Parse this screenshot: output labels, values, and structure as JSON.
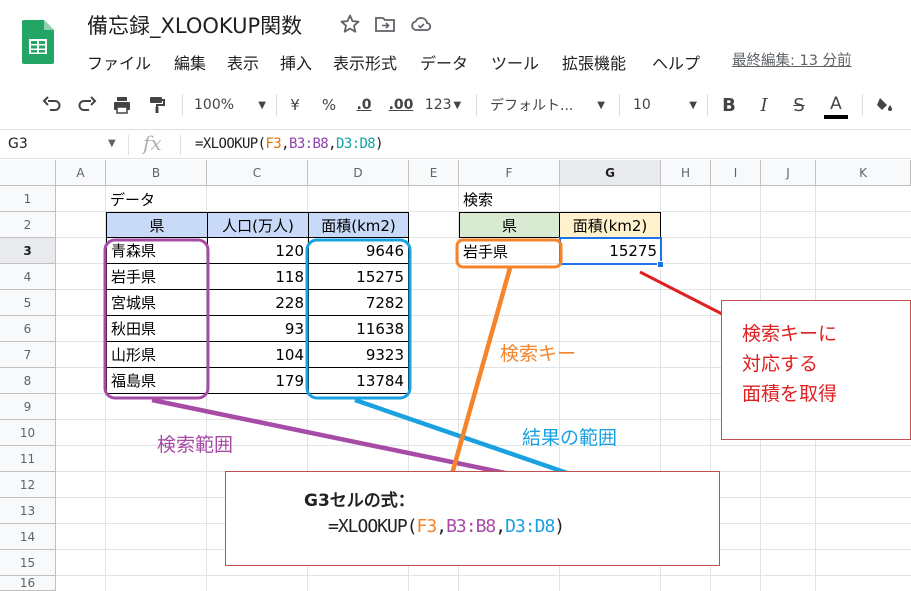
{
  "doc": {
    "title": "備忘録_XLOOKUP関数",
    "last_edit": "最終編集: 13 分前"
  },
  "menu": [
    "ファイル",
    "編集",
    "表示",
    "挿入",
    "表示形式",
    "データ",
    "ツール",
    "拡張機能",
    "ヘルプ"
  ],
  "toolbar": {
    "zoom": "100%",
    "currency": "¥",
    "percent": "%",
    "dec_decrease": ".0",
    "dec_increase": ".00",
    "more_formats": "123",
    "font": "デフォルト...",
    "font_size": "10",
    "bold": "B",
    "italic": "I",
    "strike": "S",
    "text_color": "A"
  },
  "formula_bar": {
    "name_box": "G3",
    "fx": "fx",
    "formula_parts": [
      "=XLOOKUP(",
      "F3",
      ",",
      "B3:B8",
      ",",
      "D3:D8",
      ")"
    ]
  },
  "columns": [
    "A",
    "B",
    "C",
    "D",
    "E",
    "F",
    "G",
    "H",
    "I",
    "J",
    "K"
  ],
  "rows": [
    "1",
    "2",
    "3",
    "4",
    "5",
    "6",
    "7",
    "8",
    "9",
    "10",
    "11",
    "12",
    "13",
    "14",
    "15",
    "16"
  ],
  "sheet": {
    "data_label": "データ",
    "search_label": "検索",
    "headers": [
      "県",
      "人口(万人)",
      "面積(km2)"
    ],
    "table": [
      [
        "青森県",
        "120",
        "9646"
      ],
      [
        "岩手県",
        "118",
        "15275"
      ],
      [
        "宮城県",
        "228",
        "7282"
      ],
      [
        "秋田県",
        "93",
        "11638"
      ],
      [
        "山形県",
        "104",
        "9323"
      ],
      [
        "福島県",
        "179",
        "13784"
      ]
    ],
    "search_headers": [
      "県",
      "面積(km2)"
    ],
    "search_key": "岩手県",
    "search_result": "15275"
  },
  "annotations": {
    "search_range": "検索範囲",
    "search_key": "検索キー",
    "result_range": "結果の範囲",
    "note_lines": [
      "検索キーに",
      "対応する",
      "面積を取得"
    ],
    "formula_title": "G3セルの式：",
    "formula_parts": [
      "=XLOOKUP(",
      "F3",
      ",",
      "B3:B8",
      ",",
      "D3:D8",
      ")"
    ]
  },
  "colors": {
    "purple": "#a64ca6",
    "orange": "#f5842a",
    "blue": "#1aa1e0",
    "red": "#e02020",
    "header_blue": "#c9daf8",
    "header_green": "#d9ead3",
    "header_yellow": "#fff2cc",
    "select_blue": "#1a73e8"
  }
}
